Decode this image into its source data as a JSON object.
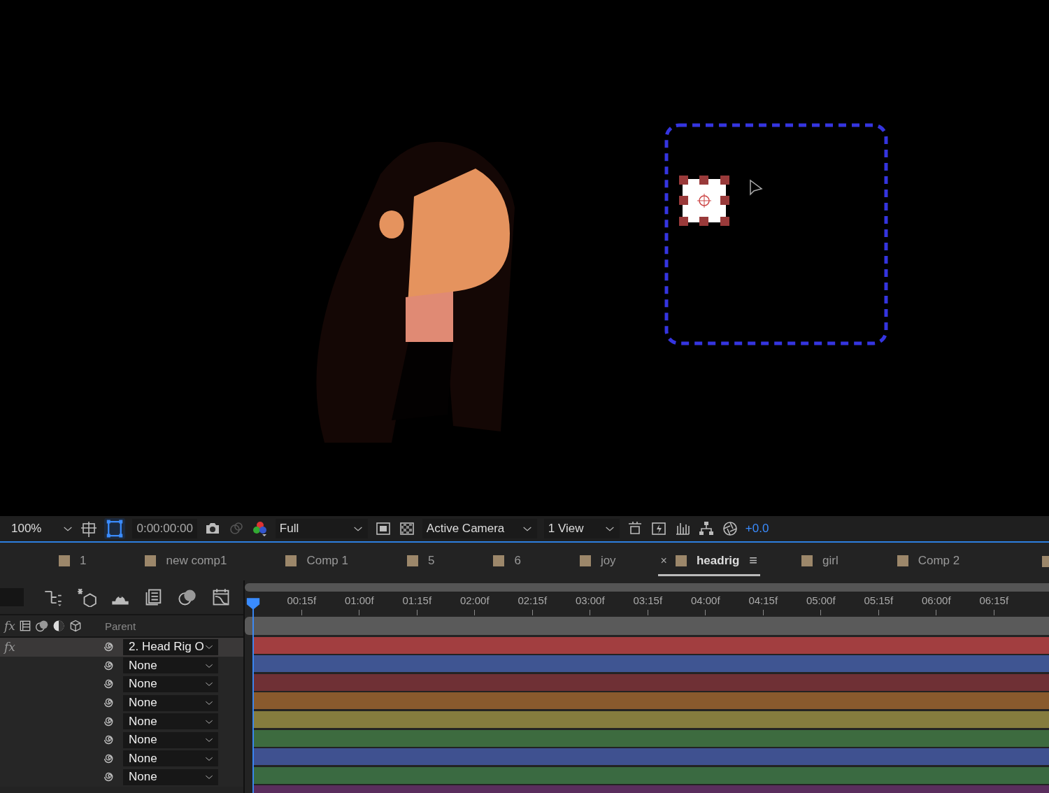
{
  "viewer_toolbar": {
    "zoom": "100%",
    "mask_toggle_on": true,
    "timecode": "0:00:00:00",
    "resolution": "Full",
    "view": "Active Camera",
    "layout": "1 View",
    "exposure": "+0.0"
  },
  "comp_tabs": [
    {
      "label": "1",
      "selected": false
    },
    {
      "label": "new comp1",
      "selected": false
    },
    {
      "label": "Comp 1",
      "selected": false
    },
    {
      "label": "5",
      "selected": false
    },
    {
      "label": "6",
      "selected": false
    },
    {
      "label": "joy",
      "selected": false
    },
    {
      "label": "headrig",
      "selected": true,
      "close": "×",
      "menu": "≡"
    },
    {
      "label": "girl",
      "selected": false
    },
    {
      "label": "Comp 2",
      "selected": false
    }
  ],
  "timeline": {
    "header": {
      "switches": "fx",
      "parent_column": "Parent"
    },
    "ruler": [
      "00:15f",
      "01:00f",
      "01:15f",
      "02:00f",
      "02:15f",
      "03:00f",
      "03:15f",
      "04:00f",
      "04:15f",
      "05:00f",
      "05:15f",
      "06:00f",
      "06:15f"
    ],
    "layers": [
      {
        "switch": "fx",
        "parent": "2. Head Rig O",
        "selected": true,
        "color": "#a23e40"
      },
      {
        "parent": "None",
        "selected": false,
        "color": "#3f5592"
      },
      {
        "parent": "None",
        "selected": false,
        "color": "#6f3035"
      },
      {
        "parent": "None",
        "selected": false,
        "color": "#895a2d"
      },
      {
        "parent": "None",
        "selected": false,
        "color": "#857c3e"
      },
      {
        "parent": "None",
        "selected": false,
        "color": "#3d6b3f"
      },
      {
        "parent": "None",
        "selected": false,
        "color": "#3f5190"
      },
      {
        "parent": "None",
        "selected": false,
        "color": "#3a6a41"
      }
    ]
  }
}
